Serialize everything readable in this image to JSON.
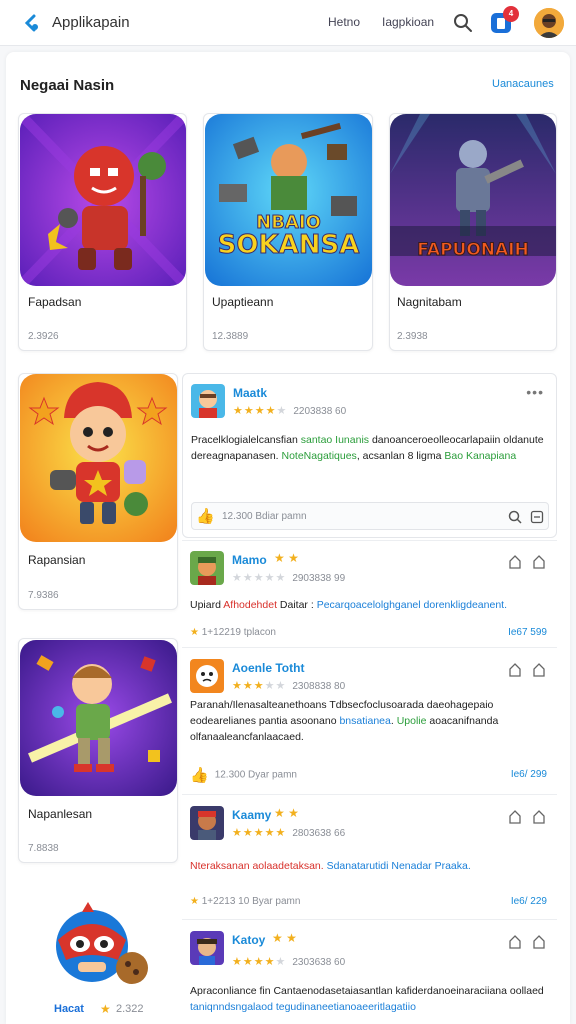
{
  "app": {
    "title": "Applikapain"
  },
  "nav": [
    "Hetno",
    "Iagpkioan"
  ],
  "notifications": {
    "count": "4"
  },
  "section": {
    "title": "Negaai Nasin",
    "see_more": "Uanacaunes"
  },
  "top_cards": [
    {
      "name": "Fapadsan",
      "meta": "2.3926"
    },
    {
      "name": "Upaptieann",
      "meta": "12.3889"
    },
    {
      "name": "Nagnitabam",
      "meta": "2.3938"
    }
  ],
  "game_art_text": {
    "card2_line1": "NBAIO",
    "card2_line2": "SOKANSA",
    "card3_line1": "FAPUONAIH"
  },
  "side_cards": [
    {
      "name": "Rapansian",
      "meta": "7.9386"
    },
    {
      "name": "Napanlesan",
      "meta": "7.8838"
    },
    {
      "name": "Hacat",
      "meta": "2.322"
    }
  ],
  "reviews": [
    {
      "name": "Maatk",
      "rating": 4,
      "date": "2203838 60",
      "text": {
        "p1": "Pracelklogialelcansfian ",
        "g1": "santao Iunanis",
        "p2": " danoanceroeolleocarlapaiin oldanute dereagnapanasen. ",
        "g2": "NoteNagatiques",
        "p3": ", acsanlan 8 ligma ",
        "g3": "Bao Kanapiana"
      },
      "reply_label": "12.300 Bdiar pamn"
    },
    {
      "name": "Mamo",
      "rating": 0,
      "date": "2903838 99",
      "text": {
        "p1": "Upiard ",
        "r1": "Afhodehdet",
        "p2": " Daitar : ",
        "b1": "Pecarqoacelolghganel dorenkligdeanent."
      },
      "foot": "1+12219 tplacon",
      "link": "Ie67 599"
    },
    {
      "name": "Aoenle Totht",
      "rating": 3,
      "date": "2308838 80",
      "text": {
        "p1": "Paranah/Ilenasalteanethoans Tdbsecfoclusoarada daeohagepaio eodearelianes pantia asoonano ",
        "b1": "bnsatianea",
        "p2": ". ",
        "g1": "Upolie",
        "p3": " aoacanifnanda olfanaaleancfanlaacaed."
      },
      "foot": "12.300 Dyar pamn",
      "link": "Ie6/ 299"
    },
    {
      "name": "Kaamy",
      "rating": 5,
      "date": "2803638 66",
      "text": {
        "r1": "Nteraksanan aolaadetaksan. ",
        "b1": "Sdanatarutidi Nenadar Praaka."
      },
      "foot": "1+2213 10 Byar pamn",
      "link": "Ie6/ 229"
    },
    {
      "name": "Katoy",
      "rating": 4,
      "date": "2303638 60",
      "text": {
        "p1": "Apraconliance fin Cantaenodasetaiasantlan kafiderdanoeinaraciiana ",
        "p2": "oollaed ",
        "b1": "taniqnndsngalaod tegudinaneetianoaeeritlagatiio"
      },
      "foot": "",
      "link": ""
    }
  ],
  "colors": {
    "accent": "#1a8ad8",
    "star": "#f2b01e",
    "green": "#2a9d3a",
    "red": "#d8312b"
  }
}
